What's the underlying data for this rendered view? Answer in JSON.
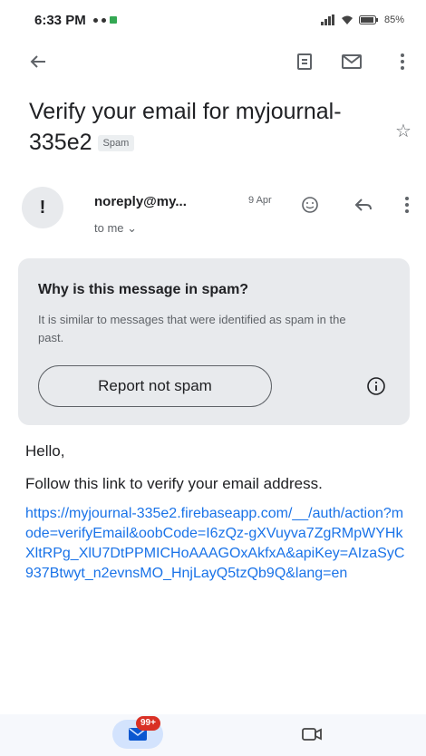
{
  "status_bar": {
    "time": "6:33 PM",
    "battery_text": "85%"
  },
  "toolbar": {
    "icons": [
      "back-arrow-icon",
      "archive-icon",
      "mark-unread-icon",
      "more-vert-icon"
    ]
  },
  "message": {
    "subject": "Verify your email for myjournal-335e2",
    "label": "Spam",
    "sender": "noreply@my...",
    "date": "9 Apr",
    "recipient_line": "to me",
    "avatar_glyph": "!"
  },
  "spam_notice": {
    "title": "Why is this message in spam?",
    "description": "It is similar to messages that were identified as spam in the past.",
    "report_button": "Report not spam"
  },
  "body": {
    "greeting": "Hello,",
    "instruction": "Follow this link to verify your email address.",
    "link": "https://myjournal-335e2.firebaseapp.com/__/auth/action?mode=verifyEmail&oobCode=I6zQz-gXVuyva7ZgRMpWYHkXltRPg_XlU7DtPPMICHoAAAGOxAkfxA&apiKey=AIzaSyC937Btwyt_n2evnsMO_HnjLayQ5tzQb9Q&lang=en"
  },
  "bottom_nav": {
    "mail_badge": "99+"
  },
  "colors": {
    "accent": "#1a73e8",
    "notice_bg": "#e8eaed",
    "badge_red": "#d93025"
  }
}
